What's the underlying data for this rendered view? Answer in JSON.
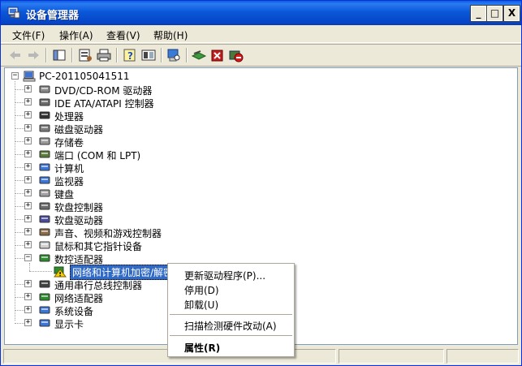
{
  "window": {
    "title": "设备管理器",
    "minimize_glyph": "_",
    "maximize_glyph": "□",
    "close_glyph": "X"
  },
  "menubar": {
    "items": [
      {
        "label": "文件(F)"
      },
      {
        "label": "操作(A)"
      },
      {
        "label": "查看(V)"
      },
      {
        "label": "帮助(H)"
      }
    ]
  },
  "toolbar": {
    "icons": [
      "back-arrow-icon",
      "forward-arrow-icon",
      "console-tree-icon",
      "properties-icon",
      "print-icon",
      "help-icon",
      "view-icon",
      "scan-hardware-icon",
      "update-driver-icon",
      "uninstall-icon",
      "disable-icon"
    ]
  },
  "tree": {
    "root": "PC-201105041511",
    "categories": [
      {
        "label": "DVD/CD-ROM 驱动器",
        "icon": "cdrom-icon"
      },
      {
        "label": "IDE ATA/ATAPI 控制器",
        "icon": "ide-controller-icon"
      },
      {
        "label": "处理器",
        "icon": "processor-icon"
      },
      {
        "label": "磁盘驱动器",
        "icon": "disk-drive-icon"
      },
      {
        "label": "存储卷",
        "icon": "storage-volume-icon"
      },
      {
        "label": "端口 (COM 和 LPT)",
        "icon": "port-icon"
      },
      {
        "label": "计算机",
        "icon": "computer-icon"
      },
      {
        "label": "监视器",
        "icon": "monitor-icon"
      },
      {
        "label": "键盘",
        "icon": "keyboard-icon"
      },
      {
        "label": "软盘控制器",
        "icon": "floppy-controller-icon"
      },
      {
        "label": "软盘驱动器",
        "icon": "floppy-drive-icon"
      },
      {
        "label": "声音、视频和游戏控制器",
        "icon": "sound-icon"
      },
      {
        "label": "鼠标和其它指针设备",
        "icon": "mouse-icon"
      },
      {
        "label": "数控适配器",
        "icon": "network-adapter-icon"
      },
      {
        "label": "通用串行总线控制器",
        "icon": "usb-icon"
      },
      {
        "label": "网络适配器",
        "icon": "network-adapter-icon"
      },
      {
        "label": "系统设备",
        "icon": "system-device-icon"
      },
      {
        "label": "显示卡",
        "icon": "display-adapter-icon"
      }
    ],
    "child_selected": "网络和计算机加密/解密"
  },
  "context_menu": {
    "items": [
      {
        "label": "更新驱动程序(P)..."
      },
      {
        "label": "停用(D)"
      },
      {
        "label": "卸载(U)"
      },
      {
        "label": "扫描检测硬件改动(A)"
      },
      {
        "label": "属性(R)"
      }
    ]
  }
}
